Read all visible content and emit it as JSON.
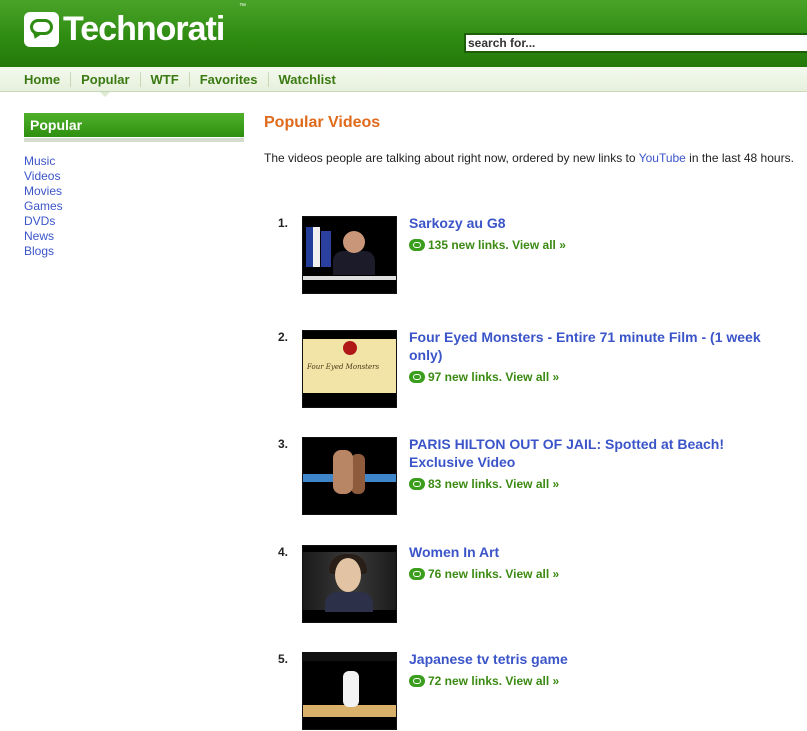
{
  "header": {
    "logo_text": "Technorati",
    "logo_tm": "™",
    "search_placeholder": "search for..."
  },
  "nav": {
    "items": [
      {
        "label": "Home"
      },
      {
        "label": "Popular"
      },
      {
        "label": "WTF"
      },
      {
        "label": "Favorites"
      },
      {
        "label": "Watchlist"
      }
    ]
  },
  "sidebar": {
    "heading": "Popular",
    "links": [
      "Music",
      "Videos",
      "Movies",
      "Games",
      "DVDs",
      "News",
      "Blogs"
    ]
  },
  "main": {
    "title": "Popular Videos",
    "intro_before": "The videos people are talking about right now, ordered by new links to ",
    "intro_link": "YouTube",
    "intro_after": " in the last 48 hours.",
    "thumb_caption_2": "Four Eyed Monsters",
    "videos": [
      {
        "rank": "1.",
        "title": "Sarkozy au G8",
        "count": "135 new links.",
        "view_all": "View all »"
      },
      {
        "rank": "2.",
        "title": "Four Eyed Monsters - Entire 71 minute Film - (1 week only)",
        "count": "97 new links.",
        "view_all": "View all »"
      },
      {
        "rank": "3.",
        "title": "PARIS HILTON OUT OF JAIL: Spotted at Beach! Exclusive Video",
        "count": "83 new links.",
        "view_all": "View all »"
      },
      {
        "rank": "4.",
        "title": "Women In Art",
        "count": "76 new links.",
        "view_all": "View all »"
      },
      {
        "rank": "5.",
        "title": "Japanese tv tetris game",
        "count": "72 new links.",
        "view_all": "View all »"
      }
    ]
  }
}
